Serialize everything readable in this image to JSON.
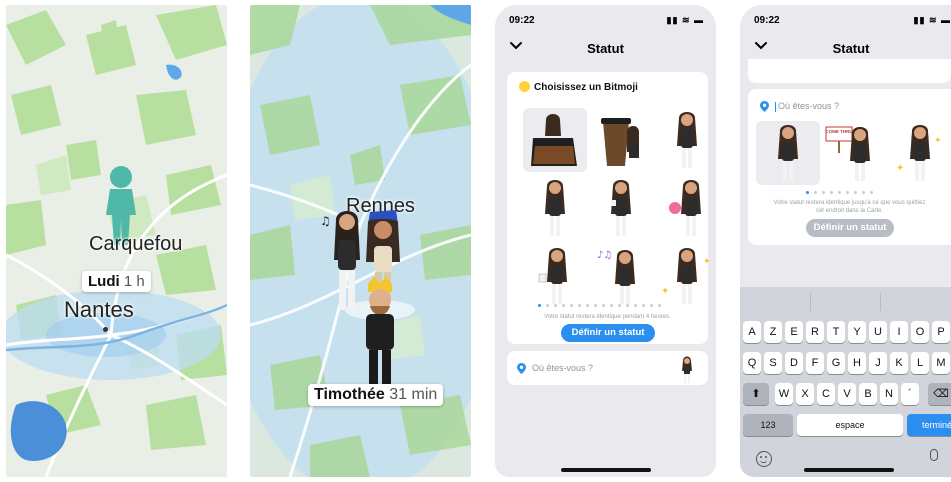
{
  "map1": {
    "cities": [
      "Carquefou",
      "Nantes"
    ],
    "friend": {
      "name": "Ludi",
      "time": "1 h"
    }
  },
  "map2": {
    "city": "Rennes",
    "friend": {
      "name": "Timothée",
      "time": "31 min"
    }
  },
  "phone1": {
    "time": "09:22",
    "title": "Statut",
    "section_title": "Choisissez un Bitmoji",
    "note": "Votre statut restera identique pendant 4 heures.",
    "button": "Définir un statut",
    "location_placeholder": "Où êtes-vous ?",
    "page_count": 16,
    "active_page": 0
  },
  "phone2": {
    "time": "09:22",
    "title": "Statut",
    "location_placeholder": "Où êtes-vous ?",
    "note_line1": "Votre statut restera identique jusqu'à ce que vous quittiez",
    "note_line2": "cet endroit dans la Carte.",
    "button": "Définir un statut",
    "sign_text": "COME THRU",
    "keyboard": {
      "row1": [
        "A",
        "Z",
        "E",
        "R",
        "T",
        "Y",
        "U",
        "I",
        "O",
        "P"
      ],
      "row2": [
        "Q",
        "S",
        "D",
        "F",
        "G",
        "H",
        "J",
        "K",
        "L",
        "M"
      ],
      "row3": [
        "W",
        "X",
        "C",
        "V",
        "B",
        "N",
        "´"
      ],
      "numbers": "123",
      "space": "espace",
      "done": "terminé"
    }
  },
  "colors": {
    "accent": "#2b8ff0",
    "map_green": "#a8d99a",
    "map_bg": "#e8efe4",
    "water": "#5fa8e8"
  }
}
